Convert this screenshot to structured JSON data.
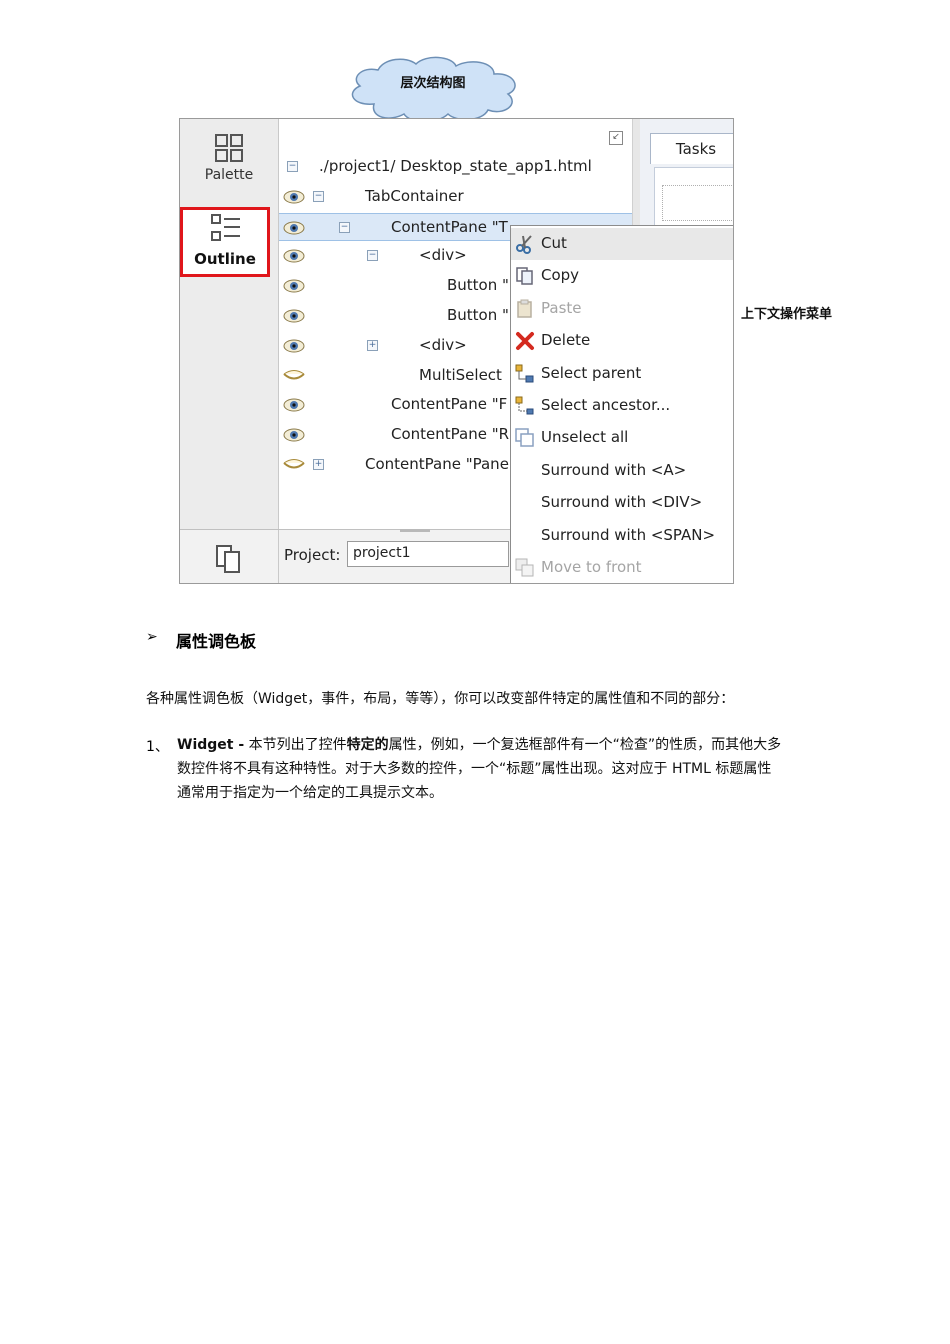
{
  "cloud": {
    "title": "层次结构图"
  },
  "sidebar": {
    "palette_label": "Palette",
    "outline_label": "Outline"
  },
  "tree": {
    "rows": [
      {
        "label": "./project1/ Desktop_state_app1.html",
        "eye": false,
        "toggle": "−"
      },
      {
        "label": "TabContainer",
        "eye": true,
        "toggle": "−"
      },
      {
        "label": "ContentPane \"T",
        "eye": true,
        "toggle": "−",
        "selected": true
      },
      {
        "label": "<div>",
        "eye": true,
        "toggle": "−"
      },
      {
        "label": "Button \"",
        "eye": true,
        "toggle": ""
      },
      {
        "label": "Button \"",
        "eye": true,
        "toggle": ""
      },
      {
        "label": "<div>",
        "eye": true,
        "toggle": "+"
      },
      {
        "label": "MultiSelect",
        "eye": "closed",
        "toggle": ""
      },
      {
        "label": "ContentPane \"F",
        "eye": true,
        "toggle": ""
      },
      {
        "label": "ContentPane \"R",
        "eye": true,
        "toggle": ""
      },
      {
        "label": "ContentPane \"Pane",
        "eye": "closed",
        "toggle": "+"
      }
    ]
  },
  "tasks": {
    "tab_label": "Tasks"
  },
  "project": {
    "label": "Project:",
    "value": "project1"
  },
  "context_menu": {
    "items": [
      {
        "label": "Cut",
        "icon": "scissors-icon",
        "disabled": false
      },
      {
        "label": "Copy",
        "icon": "copy-icon",
        "disabled": false
      },
      {
        "label": "Paste",
        "icon": "paste-icon",
        "disabled": true
      },
      {
        "label": "Delete",
        "icon": "delete-x-icon",
        "disabled": false
      },
      {
        "label": "Select parent",
        "icon": "tree-parent-icon",
        "disabled": false
      },
      {
        "label": "Select ancestor...",
        "icon": "tree-ancestor-icon",
        "disabled": false
      },
      {
        "label": "Unselect all",
        "icon": "unselect-icon",
        "disabled": false
      },
      {
        "label": "Surround with <A>",
        "icon": "",
        "disabled": false
      },
      {
        "label": "Surround with <DIV>",
        "icon": "",
        "disabled": false
      },
      {
        "label": "Surround with <SPAN>",
        "icon": "",
        "disabled": false
      },
      {
        "label": "Move to front",
        "icon": "move-front-icon",
        "disabled": true
      }
    ]
  },
  "annotation": {
    "context_menu_caption": "上下文操作菜单"
  },
  "section": {
    "bullet": "➢",
    "heading": "属性调色板",
    "intro": "各种属性调色板（Widget，事件，布局，等等），你可以改变部件特定的属性值和不同的部分：",
    "item1_num": "1、",
    "item1_term": "Widget -",
    "item1_text_a": "本节列出了控件",
    "item1_bold": "特定的",
    "item1_text_b": "属性，例如，一个复选框部件有一个“检查”的性质，而其他大多",
    "item1_line2": "数控件将不具有这种特性。对于大多数的控件，一个“标题”属性出现。这对应于 HTML 标题属性",
    "item1_line3": "通常用于指定为一个给定的工具提示文本。"
  },
  "colors": {
    "outline_highlight": "#e0161b",
    "selection": "#dbe8f7",
    "delete_red": "#d42a1f"
  }
}
